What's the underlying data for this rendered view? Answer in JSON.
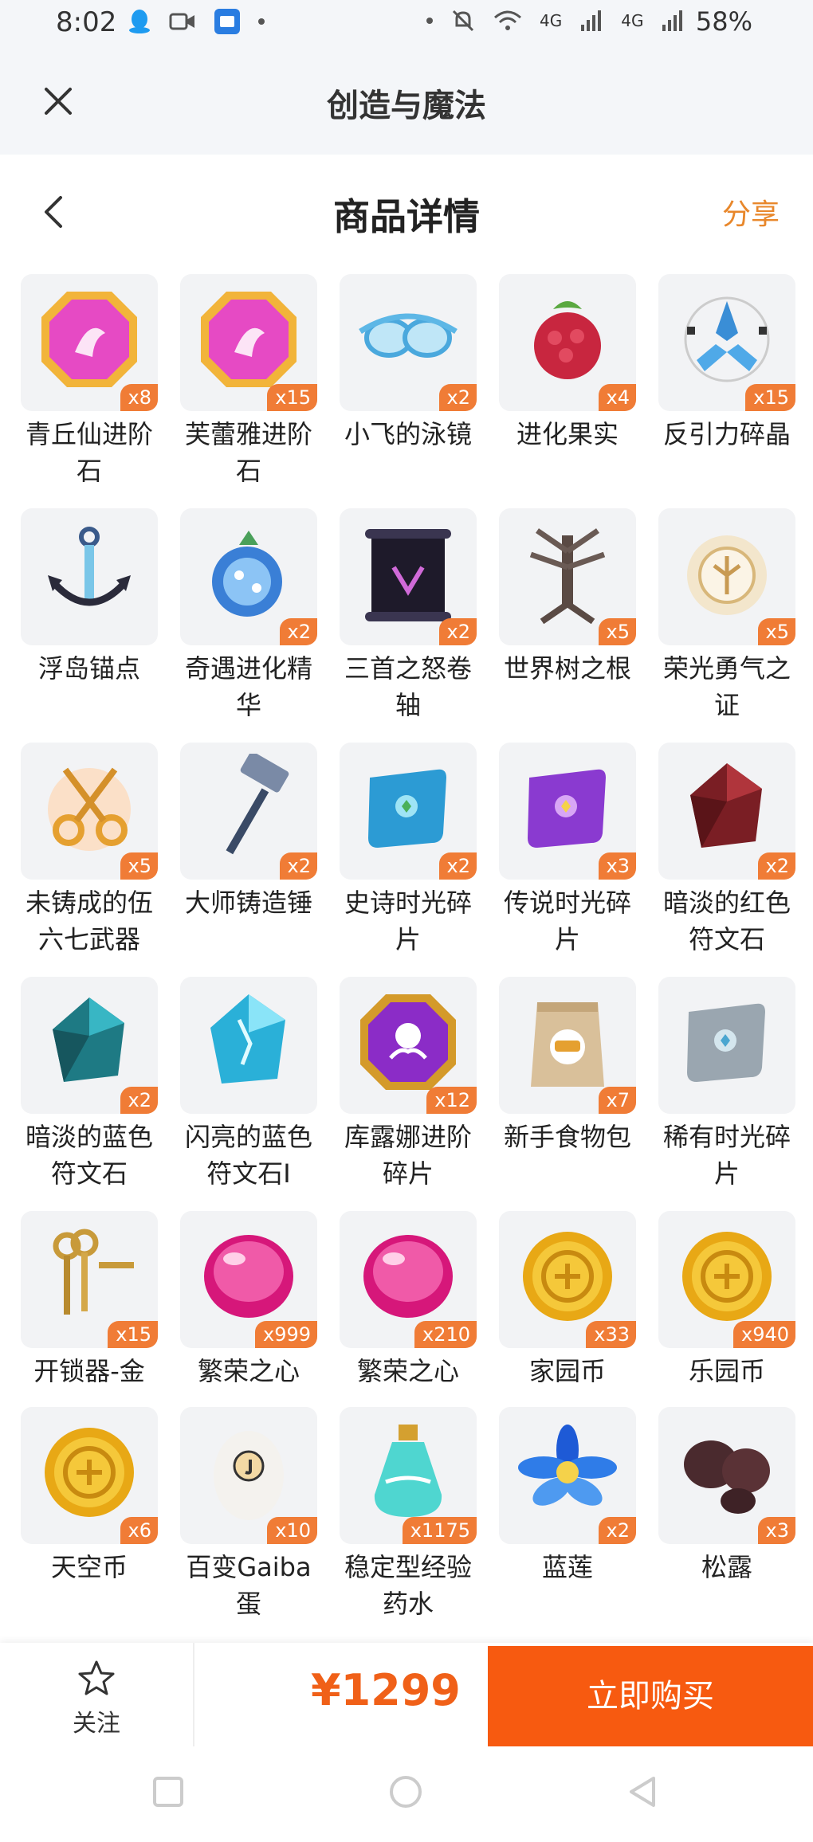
{
  "status_bar": {
    "time": "8:02",
    "network_1": "4G",
    "network_2": "4G",
    "battery": "58%"
  },
  "app": {
    "title": "创造与魔法"
  },
  "page": {
    "title": "商品详情",
    "share": "分享"
  },
  "items": [
    {
      "name": "青丘仙进阶石",
      "qty": "x8",
      "icon": "pink-gem-icon"
    },
    {
      "name": "芙蕾雅进阶石",
      "qty": "x15",
      "icon": "pink-gem-icon"
    },
    {
      "name": "小飞的泳镜",
      "qty": "x2",
      "icon": "goggles-icon"
    },
    {
      "name": "进化果实",
      "qty": "x4",
      "icon": "raspberry-fruit-icon"
    },
    {
      "name": "反引力碎晶",
      "qty": "x15",
      "icon": "antigravity-crystal-icon"
    },
    {
      "name": "浮岛锚点",
      "qty": "",
      "icon": "anchor-icon"
    },
    {
      "name": "奇遇进化精华",
      "qty": "x2",
      "icon": "blue-essence-icon"
    },
    {
      "name": "三首之怒卷轴",
      "qty": "x2",
      "icon": "scroll-icon"
    },
    {
      "name": "世界树之根",
      "qty": "x5",
      "icon": "tree-root-icon"
    },
    {
      "name": "荣光勇气之证",
      "qty": "x5",
      "icon": "badge-icon"
    },
    {
      "name": "未铸成的伍六七武器",
      "qty": "x5",
      "icon": "flaming-scissors-icon"
    },
    {
      "name": "大师铸造锤",
      "qty": "x2",
      "icon": "hammer-icon"
    },
    {
      "name": "史诗时光碎片",
      "qty": "x2",
      "icon": "blue-puzzle-icon"
    },
    {
      "name": "传说时光碎片",
      "qty": "x3",
      "icon": "purple-puzzle-icon"
    },
    {
      "name": "暗淡的红色符文石",
      "qty": "x2",
      "icon": "red-rune-stone-icon"
    },
    {
      "name": "暗淡的蓝色符文石",
      "qty": "x2",
      "icon": "teal-rune-stone-icon"
    },
    {
      "name": "闪亮的蓝色符文石I",
      "qty": "",
      "icon": "shiny-blue-rune-icon"
    },
    {
      "name": "库露娜进阶碎片",
      "qty": "x12",
      "icon": "purple-gem-icon"
    },
    {
      "name": "新手食物包",
      "qty": "x7",
      "icon": "food-bag-icon"
    },
    {
      "name": "稀有时光碎片",
      "qty": "",
      "icon": "gray-puzzle-icon"
    },
    {
      "name": "开锁器-金",
      "qty": "x15",
      "icon": "gold-keys-icon"
    },
    {
      "name": "繁荣之心",
      "qty": "x999",
      "icon": "pink-orb-icon"
    },
    {
      "name": "繁荣之心",
      "qty": "x210",
      "icon": "pink-orb-icon"
    },
    {
      "name": "家园币",
      "qty": "x33",
      "icon": "gold-coin-icon"
    },
    {
      "name": "乐园币",
      "qty": "x940",
      "icon": "gold-coin-icon"
    },
    {
      "name": "天空币",
      "qty": "x6",
      "icon": "gold-coin-icon"
    },
    {
      "name": "百变Gaiba蛋",
      "qty": "x10",
      "icon": "egg-icon"
    },
    {
      "name": "稳定型经验药水",
      "qty": "x1175",
      "icon": "potion-icon"
    },
    {
      "name": "蓝莲",
      "qty": "x2",
      "icon": "blue-lotus-icon"
    },
    {
      "name": "松露",
      "qty": "x3",
      "icon": "truffle-icon"
    }
  ],
  "bottom": {
    "follow": "关注",
    "price": "¥1299",
    "buy": "立即购买"
  },
  "colors": {
    "accent": "#f75a10",
    "share": "#e8872b",
    "badge": "#f07c36",
    "price": "#f06018"
  }
}
